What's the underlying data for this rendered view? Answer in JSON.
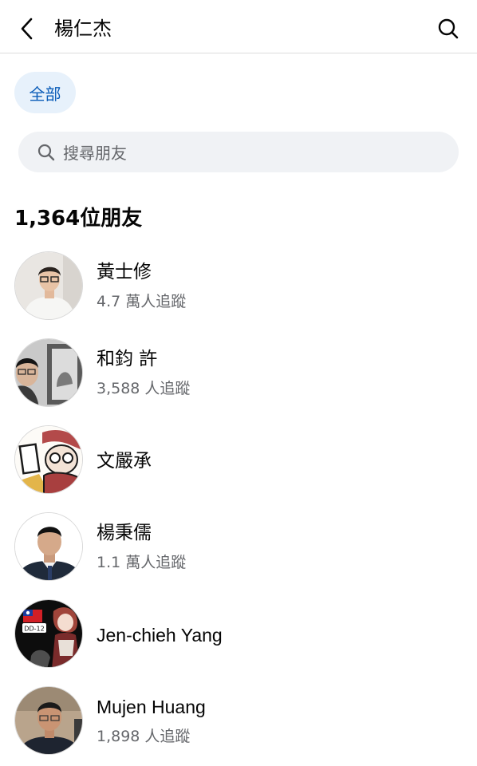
{
  "header": {
    "title": "楊仁杰",
    "back_icon": "chevron-left-icon",
    "search_icon": "search-icon"
  },
  "filter": {
    "chip_label": "全部"
  },
  "search": {
    "placeholder": "搜尋朋友"
  },
  "friends_count": "1,364位朋友",
  "friends": [
    {
      "name": "黃士修",
      "followers": "4.7 萬人追蹤"
    },
    {
      "name": "和鈞 許",
      "followers": "3,588 人追蹤"
    },
    {
      "name": "文嚴承",
      "followers": ""
    },
    {
      "name": "楊秉儒",
      "followers": "1.1 萬人追蹤"
    },
    {
      "name": "Jen-chieh Yang",
      "followers": "",
      "avatar_badge": "DD-12"
    },
    {
      "name": "Mujen Huang",
      "followers": "1,898 人追蹤"
    }
  ],
  "colors": {
    "accent": "#0a5cb8",
    "chip_bg": "#e7f1fb",
    "search_bg": "#f0f2f5",
    "secondary_text": "#65676b"
  }
}
